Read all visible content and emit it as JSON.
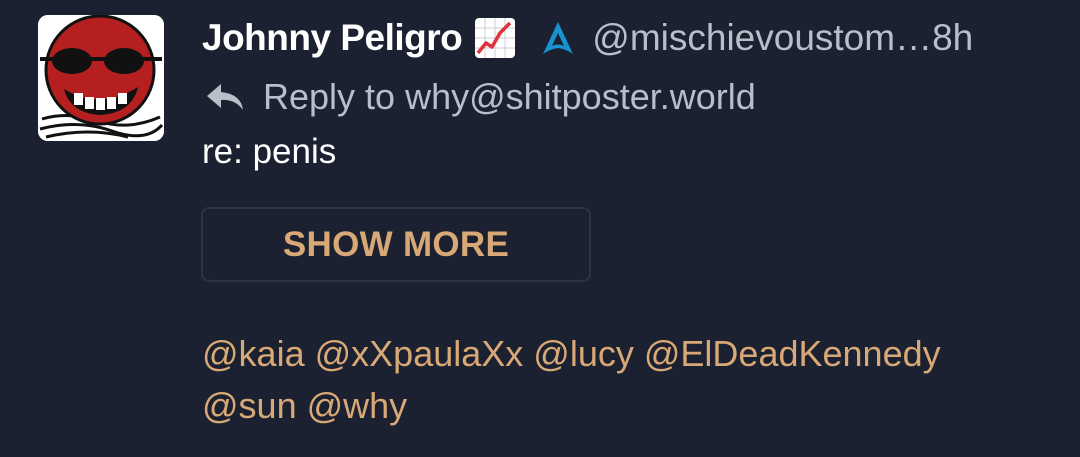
{
  "post": {
    "author": {
      "display_name": "Johnny Peligro",
      "handle": "@mischievoustom…",
      "badges": [
        "chart-increasing-emoji",
        "arch-linux-icon"
      ]
    },
    "time": "8h",
    "reply": {
      "icon": "reply-arrow-icon",
      "text": "Reply to why@shitposter.world"
    },
    "subject": "re: penis",
    "show_more_label": "SHOW MORE",
    "mentions": [
      "@kaia",
      "@xXpaulaXx",
      "@lucy",
      "@ElDeadKennedy",
      "@sun",
      "@why"
    ]
  },
  "colors": {
    "background": "#1b2130",
    "text_primary": "#ffffff",
    "text_secondary": "#b9bec8",
    "accent": "#d8a877",
    "arch_blue": "#1793d1"
  }
}
